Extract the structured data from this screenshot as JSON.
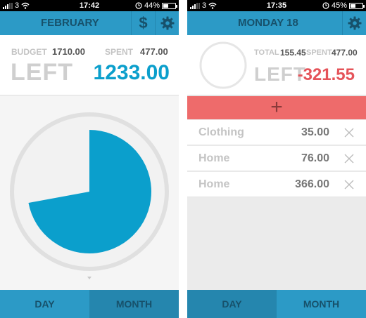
{
  "left_screen": {
    "status": {
      "carrier": "3",
      "time": "17:42",
      "battery": "44%",
      "battery_level": 0.44
    },
    "nav": {
      "title": "FEBRUARY",
      "currency_icon": "$"
    },
    "summary": {
      "budget_label": "BUDGET",
      "budget_value": "1710.00",
      "spent_label": "SPENT",
      "spent_value": "477.00",
      "left_label": "LEFT",
      "left_value": "1233.00"
    },
    "pie": {
      "remaining_fraction": 0.721,
      "color": "#0b9fcc"
    },
    "tabs": {
      "day": "DAY",
      "month": "MONTH"
    }
  },
  "right_screen": {
    "status": {
      "carrier": "3",
      "time": "17:35",
      "battery": "45%",
      "battery_level": 0.45
    },
    "nav": {
      "title": "MONDAY 18"
    },
    "summary": {
      "total_label": "TOTAL",
      "total_value": "155.45",
      "spent_label": "SPENT",
      "spent_value": "477.00",
      "left_label": "LEFT",
      "left_value": "-321.55"
    },
    "add_symbol": "+",
    "expenses": [
      {
        "category": "Clothing",
        "amount": "35.00"
      },
      {
        "category": "Home",
        "amount": "76.00"
      },
      {
        "category": "Home",
        "amount": "366.00"
      }
    ],
    "tabs": {
      "day": "DAY",
      "month": "MONTH"
    }
  },
  "colors": {
    "nav_blue": "#2c9ac6",
    "dark_blue_text": "#17516b",
    "accent_blue": "#0b9fcc",
    "negative_red": "#e5545a",
    "add_bar": "#ee6b6b"
  }
}
